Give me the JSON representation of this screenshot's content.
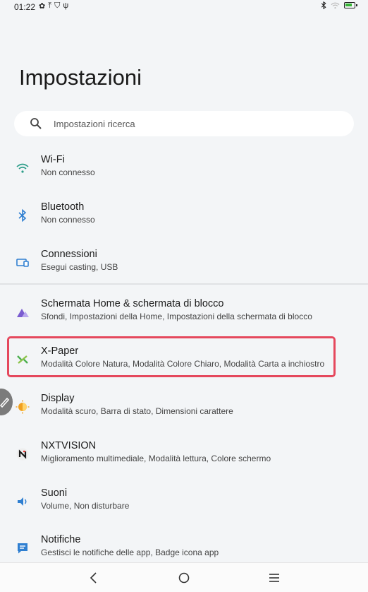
{
  "status_bar": {
    "time": "01:22",
    "left_icons": [
      "gear-icon",
      "upload-icon",
      "shield-icon",
      "usb-icon"
    ],
    "right_icons": [
      "bluetooth-icon",
      "wifi-icon",
      "battery-icon"
    ]
  },
  "page": {
    "title": "Impostazioni"
  },
  "search": {
    "placeholder": "Impostazioni ricerca"
  },
  "settings": [
    {
      "id": "wifi",
      "title": "Wi-Fi",
      "subtitle": "Non connesso",
      "icon": "wifi-icon",
      "color": "#2e9e8a"
    },
    {
      "id": "bluetooth",
      "title": "Bluetooth",
      "subtitle": "Non connesso",
      "icon": "bluetooth-icon",
      "color": "#2f7fd1"
    },
    {
      "id": "connessioni",
      "title": "Connessioni",
      "subtitle": "Esegui casting, USB",
      "icon": "cast-icon",
      "color": "#2f7fd1"
    },
    {
      "id": "home",
      "title": "Schermata Home & schermata di blocco",
      "subtitle": "Sfondi, Impostazioni della Home, Impostazioni della schermata di blocco",
      "icon": "home-screen-icon",
      "color": "#7a5cd0"
    },
    {
      "id": "xpaper",
      "title": "X-Paper",
      "subtitle": "Modalità Colore Natura, Modalità Colore Chiaro, Modalità Carta a inchiostro",
      "icon": "xpaper-icon",
      "color": "#4caf50"
    },
    {
      "id": "display",
      "title": "Display",
      "subtitle": "Modalità scuro, Barra di stato, Dimensioni carattere",
      "icon": "display-icon",
      "color": "#f0a020"
    },
    {
      "id": "nxtvision",
      "title": "NXTVISION",
      "subtitle": "Miglioramento multimediale, Modalità lettura, Colore schermo",
      "icon": "nxtvision-icon",
      "color": "#222222"
    },
    {
      "id": "suoni",
      "title": "Suoni",
      "subtitle": "Volume, Non disturbare",
      "icon": "speaker-icon",
      "color": "#2f7fd1"
    },
    {
      "id": "notifiche",
      "title": "Notifiche",
      "subtitle": "Gestisci le notifiche delle app, Badge icona app",
      "icon": "notification-icon",
      "color": "#2f7fd1"
    }
  ],
  "highlight_color": "#e5485d",
  "nav_bar": {
    "buttons": [
      "back-icon",
      "home-icon",
      "menu-icon"
    ]
  }
}
